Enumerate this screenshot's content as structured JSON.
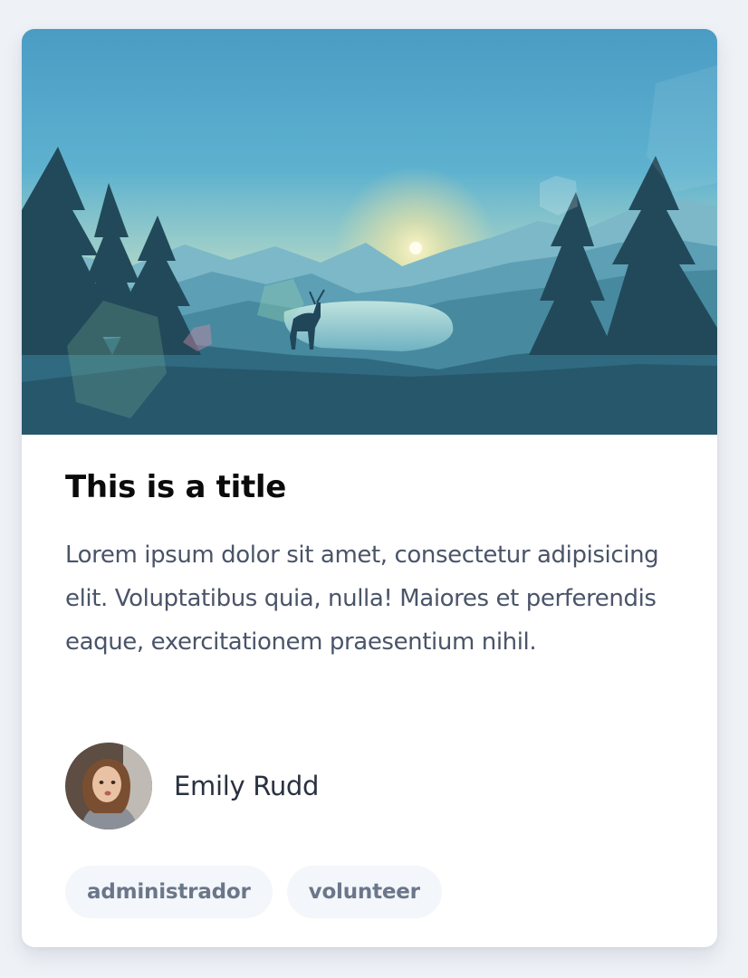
{
  "card": {
    "title": "This is a title",
    "description": "Lorem ipsum dolor sit amet, consectetur adipisicing elit. Voluptatibus quia, nulla! Maiores et perferendis eaque, exercitationem praesentium nihil.",
    "author": {
      "name": "Emily Rudd",
      "avatar_icon": "avatar-portrait"
    },
    "tags": [
      "administrador",
      "volunteer"
    ],
    "hero_image": "landscape-deer-lake-sunset"
  },
  "colors": {
    "page_background": "#eef1f6",
    "card_background": "#ffffff",
    "title": "#0b0b0b",
    "body_text": "#4a5469",
    "tag_background": "#f3f6fa",
    "tag_text": "#6b768a"
  }
}
